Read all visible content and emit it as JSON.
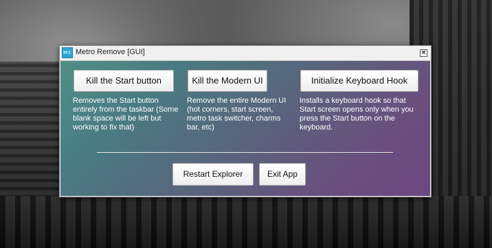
{
  "window": {
    "title": "Metro Remove [GUI]",
    "icon_label": "M↕",
    "close_glyph": "×"
  },
  "actions": [
    {
      "label": "Kill the Start button",
      "description": "Removes the Start button entirely from the taskbar (Some blank space will be left but working to fix that)"
    },
    {
      "label": "Kill the Modern UI",
      "description": "Remove the entire Modern UI (hot corners, start screen, metro task switcher, charms bar, etc)"
    },
    {
      "label": "Initialize Keyboard Hook",
      "description": "Installs a keyboard hook so that Start screen opens only when you press the Start button on the keyboard."
    }
  ],
  "footer": {
    "restart_label": "Restart Explorer",
    "exit_label": "Exit App"
  },
  "colors": {
    "gradient_start": "#4e8f86",
    "gradient_end": "#6d4880",
    "text": "#ffffff"
  },
  "icons": {
    "app": "metro-remove-app-icon",
    "close": "close-icon"
  }
}
